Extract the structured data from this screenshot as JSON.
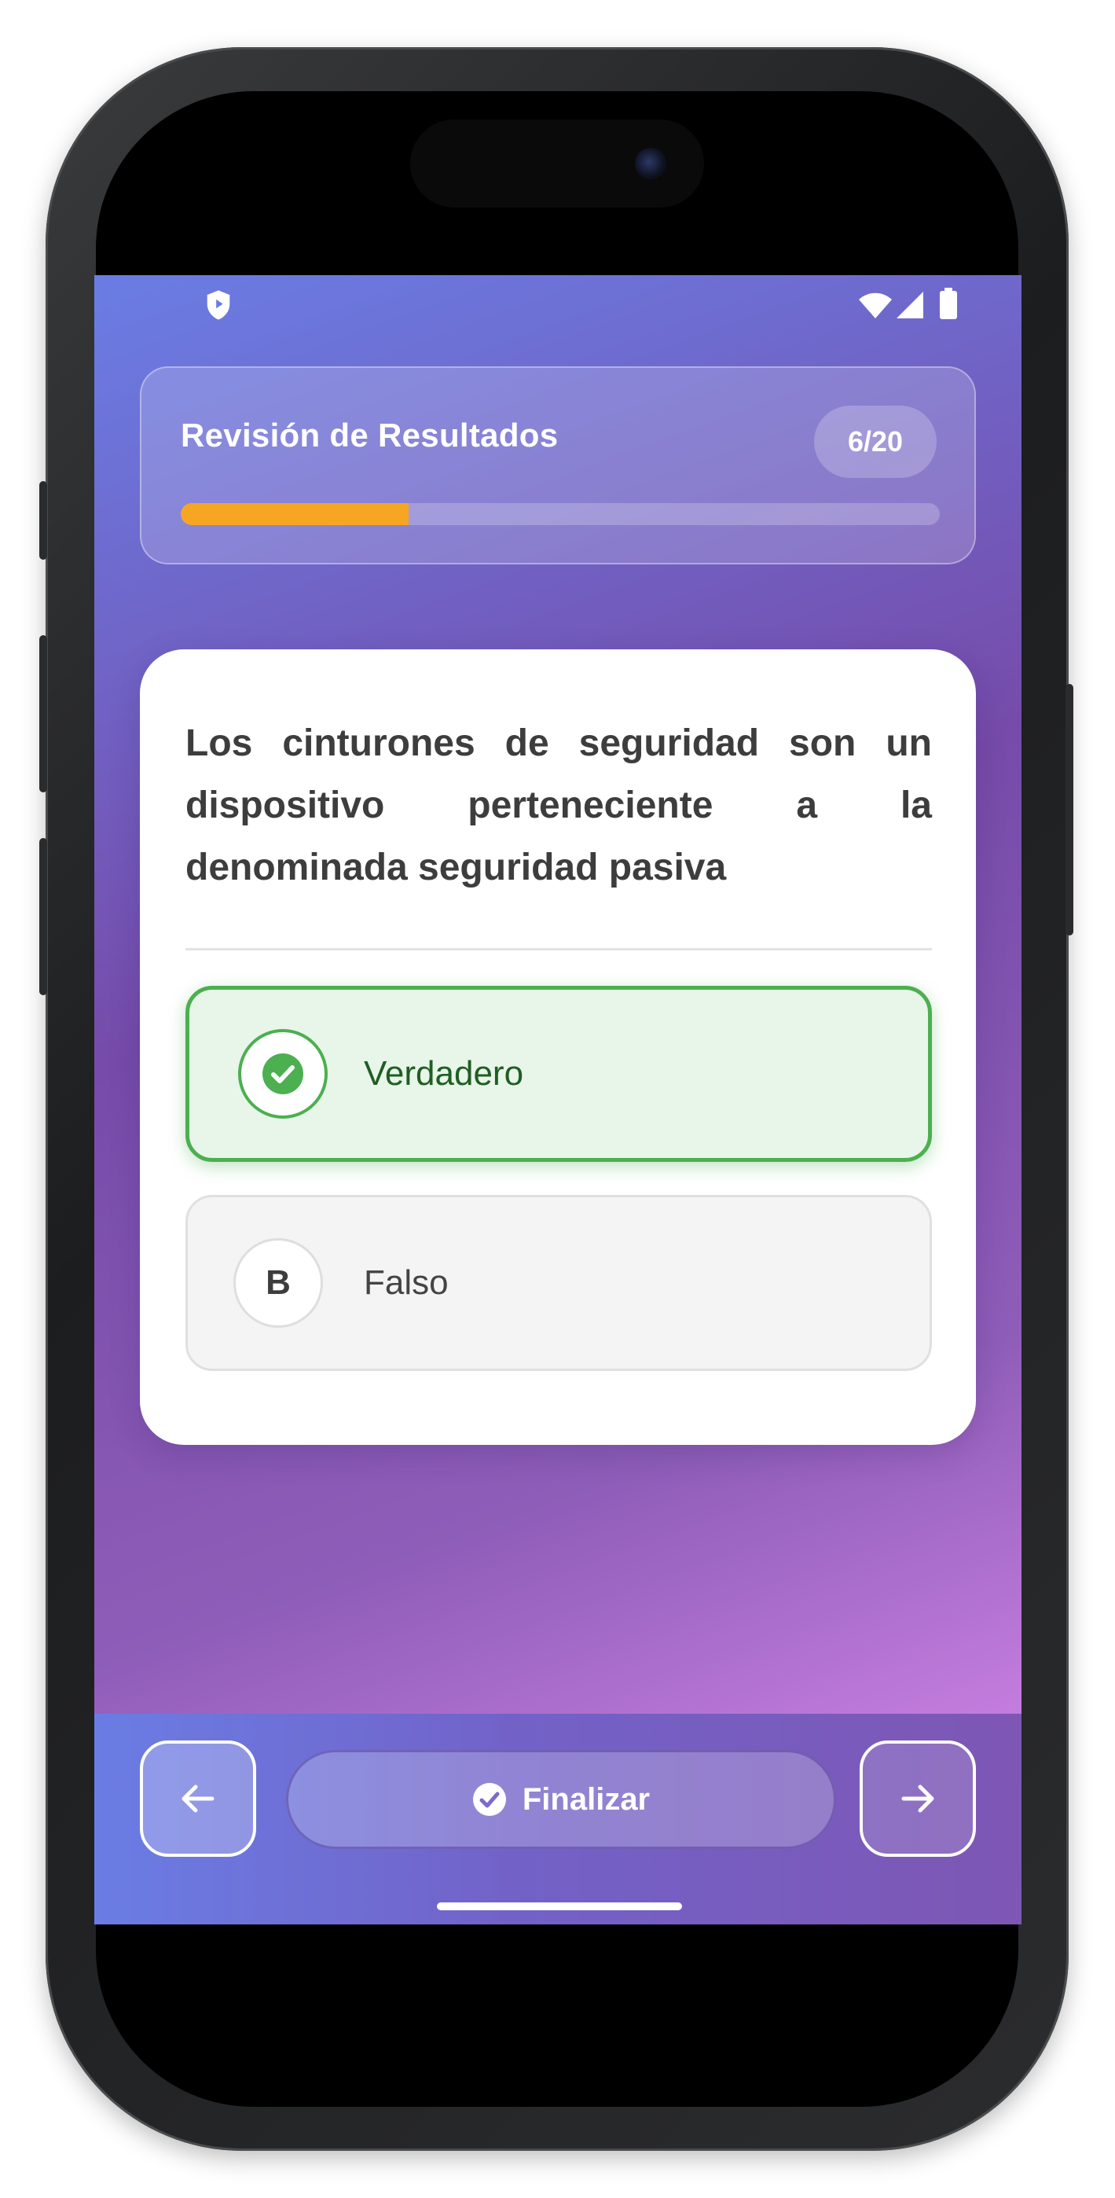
{
  "status_bar": {
    "left_icon": "shield-icon",
    "right_icons": [
      "wifi-icon",
      "signal-icon",
      "battery-icon"
    ]
  },
  "header": {
    "title": "Revisión de Resultados",
    "counter": "6/20",
    "progress_fraction": 0.3,
    "progress_color": "#f6a623"
  },
  "question": {
    "text": "Los cinturones de seguridad son un dispositivo perteneciente a la denominada seguridad pasiva",
    "options": [
      {
        "marker_icon": "check-circle-icon",
        "label": "Verdadero",
        "state": "correct"
      },
      {
        "marker": "B",
        "label": "Falso",
        "state": "unselected"
      }
    ]
  },
  "bottom_nav": {
    "prev_icon": "arrow-left-icon",
    "finish_icon": "check-circle-icon",
    "finish_label": "Finalizar",
    "next_icon": "arrow-right-icon"
  },
  "colors": {
    "correct_green": "#4caf50",
    "correct_bg": "#e8f5e9",
    "gradient_start": "#6a7de4",
    "gradient_end": "#e28ef2"
  }
}
